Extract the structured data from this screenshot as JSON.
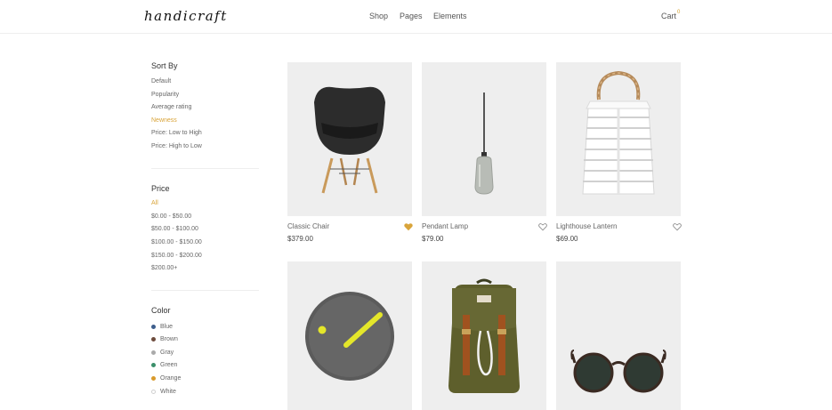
{
  "header": {
    "logo": "handicraft",
    "nav": {
      "shop": "Shop",
      "pages": "Pages",
      "elements": "Elements"
    },
    "cart_label": "Cart",
    "cart_count": "0"
  },
  "sidebar": {
    "sort": {
      "title": "Sort By",
      "options": [
        "Default",
        "Popularity",
        "Average rating",
        "Newness",
        "Price: Low to High",
        "Price: High to Low"
      ],
      "active": "Newness"
    },
    "price": {
      "title": "Price",
      "options": [
        "All",
        "$0.00 - $50.00",
        "$50.00 - $100.00",
        "$100.00 - $150.00",
        "$150.00 - $200.00",
        "$200.00+"
      ],
      "active": "All"
    },
    "color": {
      "title": "Color",
      "options": [
        {
          "label": "Blue",
          "color": "#3d5e8c"
        },
        {
          "label": "Brown",
          "color": "#6d4c3d"
        },
        {
          "label": "Gray",
          "color": "#aaaaaa"
        },
        {
          "label": "Green",
          "color": "#3b8f6a"
        },
        {
          "label": "Orange",
          "color": "#d99a2b"
        },
        {
          "label": "White",
          "color": "#ffffff"
        }
      ]
    }
  },
  "products": [
    {
      "name": "Classic Chair",
      "price": "$379.00",
      "favorited": true,
      "image": "chair"
    },
    {
      "name": "Pendant Lamp",
      "price": "$79.00",
      "favorited": false,
      "image": "pendant-lamp"
    },
    {
      "name": "Lighthouse Lantern",
      "price": "$69.00",
      "favorited": false,
      "image": "lantern"
    },
    {
      "name": "",
      "price": "",
      "favorited": false,
      "image": "wall-clock"
    },
    {
      "name": "",
      "price": "",
      "favorited": false,
      "image": "backpack"
    },
    {
      "name": "",
      "price": "",
      "favorited": false,
      "image": "sunglasses"
    }
  ],
  "colors": {
    "accent": "#d9a43a",
    "image_bg": "#eeeeee"
  }
}
